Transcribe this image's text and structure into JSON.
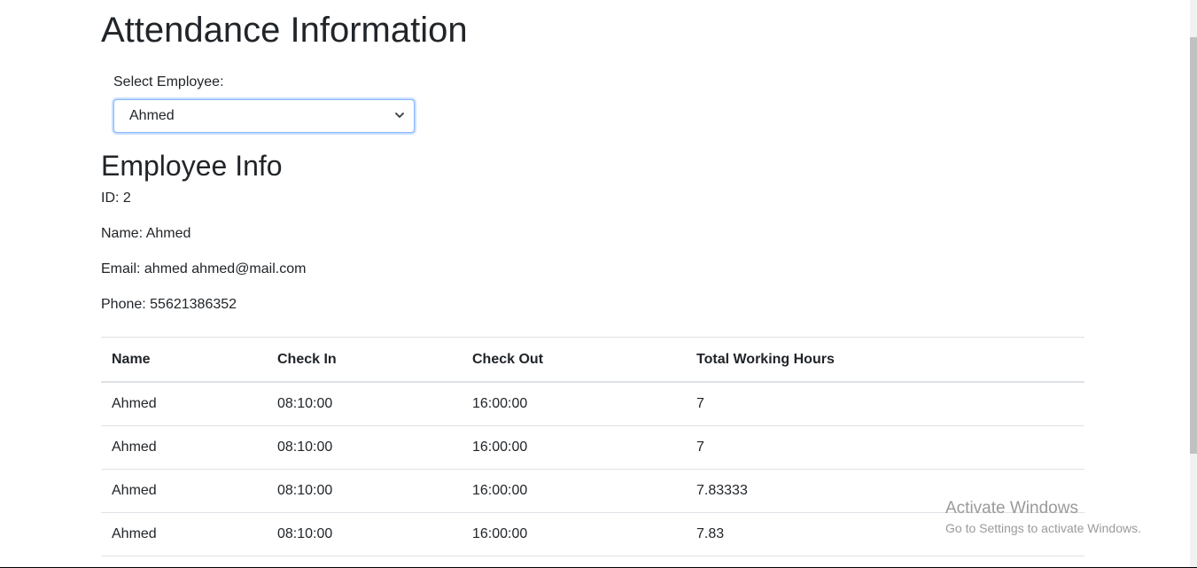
{
  "page": {
    "title": "Attendance Information"
  },
  "employee_select": {
    "label": "Select Employee:",
    "selected": "Ahmed"
  },
  "employee_info": {
    "heading": "Employee Info",
    "id_line": "ID: 2",
    "name_line": "Name: Ahmed",
    "email_line": "Email: ahmed ahmed@mail.com",
    "phone_line": "Phone: 55621386352"
  },
  "attendance_table": {
    "headers": [
      "Name",
      "Check In",
      "Check Out",
      "Total Working Hours"
    ],
    "rows": [
      [
        "Ahmed",
        "08:10:00",
        "16:00:00",
        "7"
      ],
      [
        "Ahmed",
        "08:10:00",
        "16:00:00",
        "7"
      ],
      [
        "Ahmed",
        "08:10:00",
        "16:00:00",
        "7.83333"
      ],
      [
        "Ahmed",
        "08:10:00",
        "16:00:00",
        "7.83"
      ]
    ]
  },
  "watermark": {
    "title": "Activate Windows",
    "subtitle": "Go to Settings to activate Windows."
  },
  "icons": {
    "select_arrow": "chevron-down-icon"
  },
  "colors": {
    "text": "#212529",
    "focus_border": "#86b7fe",
    "table_border": "#dee2e6",
    "watermark": "#9a9a9a"
  }
}
